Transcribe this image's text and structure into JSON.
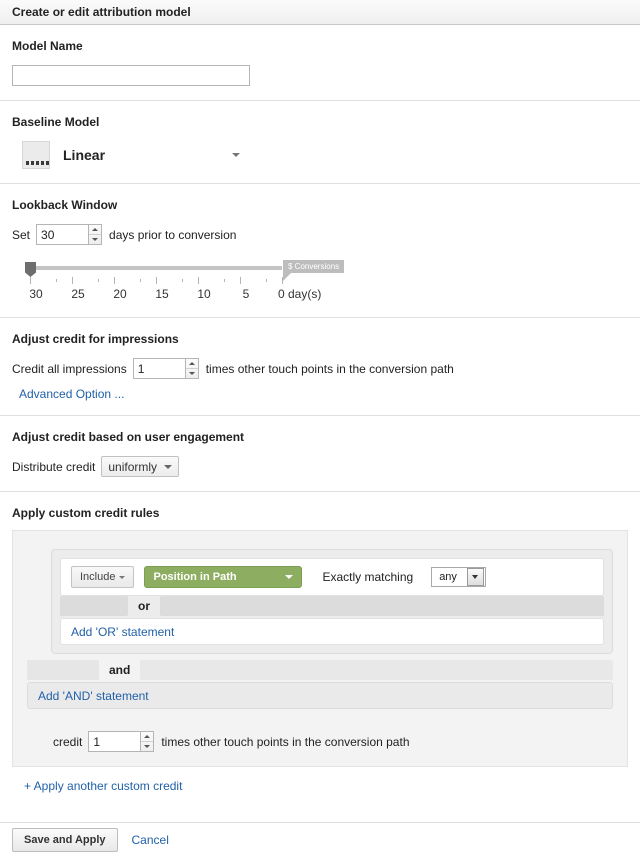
{
  "window": {
    "title": "Create or edit attribution model"
  },
  "model_name": {
    "label": "Model Name",
    "value": "",
    "placeholder": ""
  },
  "baseline_model": {
    "label": "Baseline Model",
    "selected": "Linear",
    "icon": "linear-model-icon"
  },
  "lookback": {
    "label": "Lookback Window",
    "set_label": "Set",
    "days_value": "30",
    "suffix": "days prior to conversion",
    "slider": {
      "handle_value": "30",
      "bubble_label": "$ Conversions",
      "tick_labels": [
        "30",
        "25",
        "20",
        "15",
        "10",
        "5",
        "0 day(s)"
      ]
    }
  },
  "impressions": {
    "title": "Adjust credit for impressions",
    "pre_label": "Credit all impressions",
    "value": "1",
    "post_label": "times other touch points in the conversion path",
    "advanced_link": "Advanced Option ..."
  },
  "engagement": {
    "title": "Adjust credit based on user engagement",
    "pre_label": "Distribute credit",
    "selected": "uniformly"
  },
  "custom_rules": {
    "title": "Apply custom credit rules",
    "condition": {
      "include_label": "Include",
      "dimension": "Position in Path",
      "match_label": "Exactly matching",
      "match_value": "any"
    },
    "or_word": "or",
    "add_or_label": "Add 'OR' statement",
    "and_word": "and",
    "add_and_label": "Add 'AND' statement",
    "credit": {
      "pre_label": "credit",
      "value": "1",
      "post_label": "times other touch points in the conversion path"
    },
    "apply_another_label": "+ Apply another custom credit"
  },
  "footer": {
    "save_label": "Save and Apply",
    "cancel_label": "Cancel"
  },
  "colors": {
    "accent_green": "#8dae60",
    "link_blue": "#2161a8",
    "panel_gray": "#f3f3f3"
  }
}
